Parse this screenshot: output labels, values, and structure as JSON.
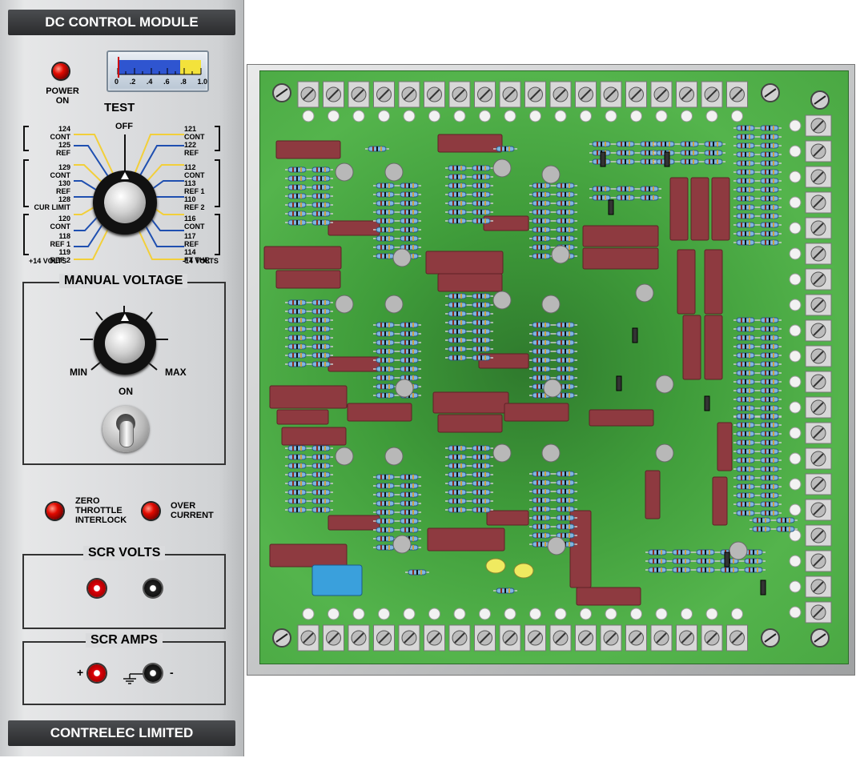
{
  "panel": {
    "title": "DC CONTROL MODULE",
    "footer": "CONTRELEC LIMITED",
    "power_label_1": "POWER",
    "power_label_2": "ON",
    "meter_scale": [
      "0",
      ".2",
      ".4",
      ".6",
      ".8",
      "1.0"
    ],
    "test": {
      "title": "TEST",
      "off": "OFF",
      "left": [
        {
          "num": "124",
          "text": "CONT"
        },
        {
          "num": "125",
          "text": "REF"
        },
        {
          "num": "129",
          "text": "CONT"
        },
        {
          "num": "130",
          "text": "REF"
        },
        {
          "num": "128",
          "text": "CUR LIMIT"
        },
        {
          "num": "120",
          "text": "CONT"
        },
        {
          "num": "118",
          "text": "REF 1"
        },
        {
          "num": "119",
          "text": "REF 2"
        }
      ],
      "left_bottom": "+14 VOLTS",
      "right": [
        {
          "num": "121",
          "text": "CONT"
        },
        {
          "num": "122",
          "text": "REF"
        },
        {
          "num": "112",
          "text": "CONT"
        },
        {
          "num": "113",
          "text": "REF 1"
        },
        {
          "num": "110",
          "text": "REF 2"
        },
        {
          "num": "116",
          "text": "CONT"
        },
        {
          "num": "117",
          "text": "REF"
        },
        {
          "num": "114",
          "text": "FT THR"
        }
      ],
      "right_bottom": "-14 VOLTS"
    },
    "manual_voltage": {
      "title": "MANUAL VOLTAGE",
      "min": "MIN",
      "max": "MAX",
      "on": "ON"
    },
    "zero_throttle": [
      "ZERO",
      "THROTTLE",
      "INTERLOCK"
    ],
    "over_current": [
      "OVER",
      "CURRENT"
    ],
    "scr_volts": {
      "title": "SCR VOLTS"
    },
    "scr_amps": {
      "title": "SCR AMPS",
      "plus": "+",
      "minus": "-"
    }
  },
  "colors": {
    "panel": "#dadbdd",
    "header": "#333436",
    "led_red": "#e10a00",
    "pcb_green": "#4aa843",
    "resistor_body": "#8e3a40",
    "selector_wire_yellow": "#f2cf3a",
    "selector_wire_blue": "#1f4fb0"
  }
}
